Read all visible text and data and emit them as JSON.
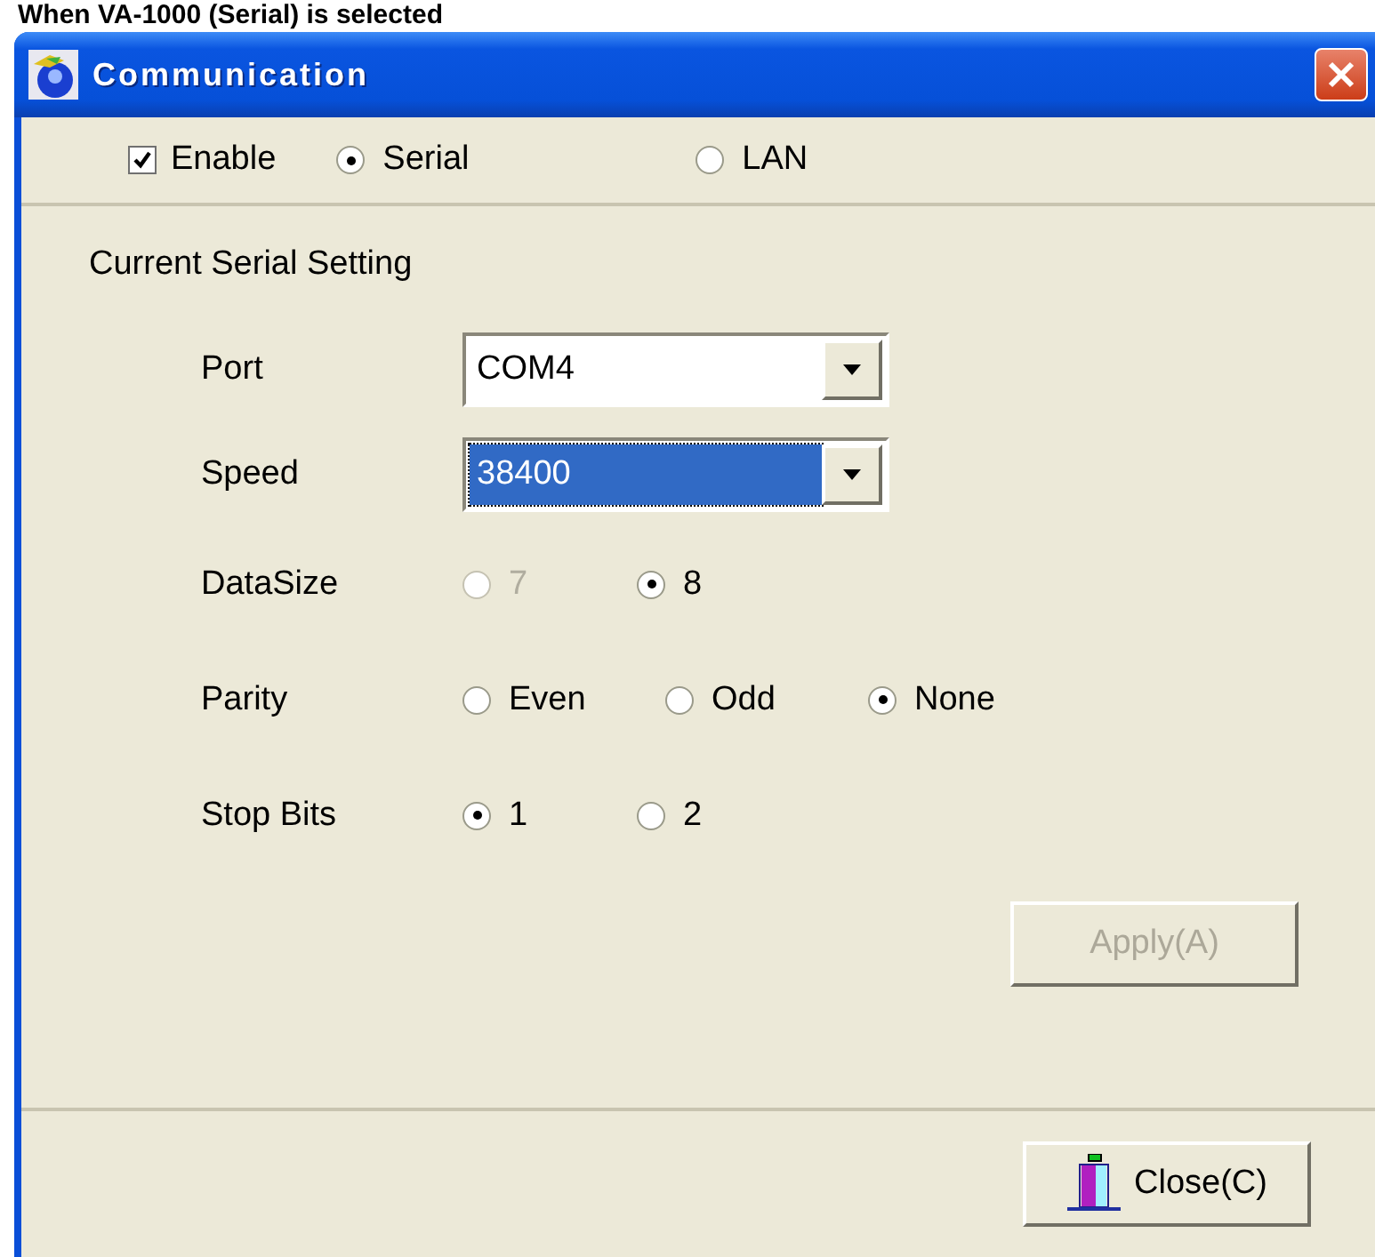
{
  "caption": "When VA-1000 (Serial) is selected",
  "window": {
    "title": "Communication"
  },
  "mode_row": {
    "enable": {
      "label": "Enable",
      "checked": true
    },
    "interfaces": [
      {
        "label": "Serial",
        "selected": true
      },
      {
        "label": "LAN",
        "selected": false
      }
    ]
  },
  "group": {
    "title": "Current Serial Setting",
    "rows": [
      {
        "kind": "combo",
        "label": "Port",
        "value": "COM4",
        "focused": false
      },
      {
        "kind": "combo",
        "label": "Speed",
        "value": "38400",
        "focused": true
      },
      {
        "kind": "radio",
        "label": "DataSize",
        "options": [
          {
            "label": "7",
            "selected": false,
            "disabled": true
          },
          {
            "label": "8",
            "selected": true,
            "disabled": false
          }
        ]
      },
      {
        "kind": "radio",
        "label": "Parity",
        "options": [
          {
            "label": "Even",
            "selected": false,
            "disabled": false
          },
          {
            "label": "Odd",
            "selected": false,
            "disabled": false
          },
          {
            "label": "None",
            "selected": true,
            "disabled": false
          }
        ]
      },
      {
        "kind": "radio",
        "label": "Stop Bits",
        "options": [
          {
            "label": "1",
            "selected": true,
            "disabled": false
          },
          {
            "label": "2",
            "selected": false,
            "disabled": false
          }
        ]
      }
    ],
    "apply_button": {
      "label": "Apply(A)",
      "disabled": true
    }
  },
  "close_button": {
    "label": "Close(C)"
  }
}
